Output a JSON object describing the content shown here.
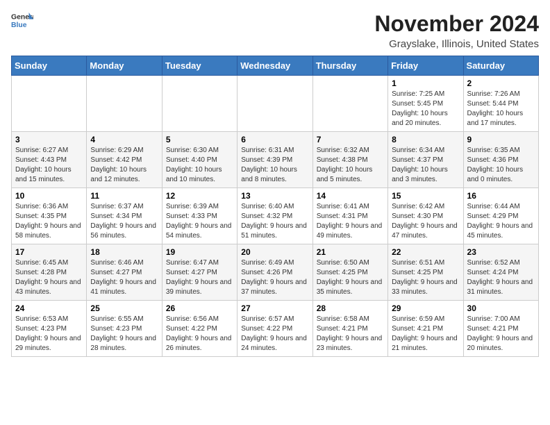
{
  "header": {
    "logo_line1": "General",
    "logo_line2": "Blue",
    "month_title": "November 2024",
    "location": "Grayslake, Illinois, United States"
  },
  "weekdays": [
    "Sunday",
    "Monday",
    "Tuesday",
    "Wednesday",
    "Thursday",
    "Friday",
    "Saturday"
  ],
  "weeks": [
    [
      {
        "day": "",
        "info": ""
      },
      {
        "day": "",
        "info": ""
      },
      {
        "day": "",
        "info": ""
      },
      {
        "day": "",
        "info": ""
      },
      {
        "day": "",
        "info": ""
      },
      {
        "day": "1",
        "info": "Sunrise: 7:25 AM\nSunset: 5:45 PM\nDaylight: 10 hours and 20 minutes."
      },
      {
        "day": "2",
        "info": "Sunrise: 7:26 AM\nSunset: 5:44 PM\nDaylight: 10 hours and 17 minutes."
      }
    ],
    [
      {
        "day": "3",
        "info": "Sunrise: 6:27 AM\nSunset: 4:43 PM\nDaylight: 10 hours and 15 minutes."
      },
      {
        "day": "4",
        "info": "Sunrise: 6:29 AM\nSunset: 4:42 PM\nDaylight: 10 hours and 12 minutes."
      },
      {
        "day": "5",
        "info": "Sunrise: 6:30 AM\nSunset: 4:40 PM\nDaylight: 10 hours and 10 minutes."
      },
      {
        "day": "6",
        "info": "Sunrise: 6:31 AM\nSunset: 4:39 PM\nDaylight: 10 hours and 8 minutes."
      },
      {
        "day": "7",
        "info": "Sunrise: 6:32 AM\nSunset: 4:38 PM\nDaylight: 10 hours and 5 minutes."
      },
      {
        "day": "8",
        "info": "Sunrise: 6:34 AM\nSunset: 4:37 PM\nDaylight: 10 hours and 3 minutes."
      },
      {
        "day": "9",
        "info": "Sunrise: 6:35 AM\nSunset: 4:36 PM\nDaylight: 10 hours and 0 minutes."
      }
    ],
    [
      {
        "day": "10",
        "info": "Sunrise: 6:36 AM\nSunset: 4:35 PM\nDaylight: 9 hours and 58 minutes."
      },
      {
        "day": "11",
        "info": "Sunrise: 6:37 AM\nSunset: 4:34 PM\nDaylight: 9 hours and 56 minutes."
      },
      {
        "day": "12",
        "info": "Sunrise: 6:39 AM\nSunset: 4:33 PM\nDaylight: 9 hours and 54 minutes."
      },
      {
        "day": "13",
        "info": "Sunrise: 6:40 AM\nSunset: 4:32 PM\nDaylight: 9 hours and 51 minutes."
      },
      {
        "day": "14",
        "info": "Sunrise: 6:41 AM\nSunset: 4:31 PM\nDaylight: 9 hours and 49 minutes."
      },
      {
        "day": "15",
        "info": "Sunrise: 6:42 AM\nSunset: 4:30 PM\nDaylight: 9 hours and 47 minutes."
      },
      {
        "day": "16",
        "info": "Sunrise: 6:44 AM\nSunset: 4:29 PM\nDaylight: 9 hours and 45 minutes."
      }
    ],
    [
      {
        "day": "17",
        "info": "Sunrise: 6:45 AM\nSunset: 4:28 PM\nDaylight: 9 hours and 43 minutes."
      },
      {
        "day": "18",
        "info": "Sunrise: 6:46 AM\nSunset: 4:27 PM\nDaylight: 9 hours and 41 minutes."
      },
      {
        "day": "19",
        "info": "Sunrise: 6:47 AM\nSunset: 4:27 PM\nDaylight: 9 hours and 39 minutes."
      },
      {
        "day": "20",
        "info": "Sunrise: 6:49 AM\nSunset: 4:26 PM\nDaylight: 9 hours and 37 minutes."
      },
      {
        "day": "21",
        "info": "Sunrise: 6:50 AM\nSunset: 4:25 PM\nDaylight: 9 hours and 35 minutes."
      },
      {
        "day": "22",
        "info": "Sunrise: 6:51 AM\nSunset: 4:25 PM\nDaylight: 9 hours and 33 minutes."
      },
      {
        "day": "23",
        "info": "Sunrise: 6:52 AM\nSunset: 4:24 PM\nDaylight: 9 hours and 31 minutes."
      }
    ],
    [
      {
        "day": "24",
        "info": "Sunrise: 6:53 AM\nSunset: 4:23 PM\nDaylight: 9 hours and 29 minutes."
      },
      {
        "day": "25",
        "info": "Sunrise: 6:55 AM\nSunset: 4:23 PM\nDaylight: 9 hours and 28 minutes."
      },
      {
        "day": "26",
        "info": "Sunrise: 6:56 AM\nSunset: 4:22 PM\nDaylight: 9 hours and 26 minutes."
      },
      {
        "day": "27",
        "info": "Sunrise: 6:57 AM\nSunset: 4:22 PM\nDaylight: 9 hours and 24 minutes."
      },
      {
        "day": "28",
        "info": "Sunrise: 6:58 AM\nSunset: 4:21 PM\nDaylight: 9 hours and 23 minutes."
      },
      {
        "day": "29",
        "info": "Sunrise: 6:59 AM\nSunset: 4:21 PM\nDaylight: 9 hours and 21 minutes."
      },
      {
        "day": "30",
        "info": "Sunrise: 7:00 AM\nSunset: 4:21 PM\nDaylight: 9 hours and 20 minutes."
      }
    ]
  ]
}
